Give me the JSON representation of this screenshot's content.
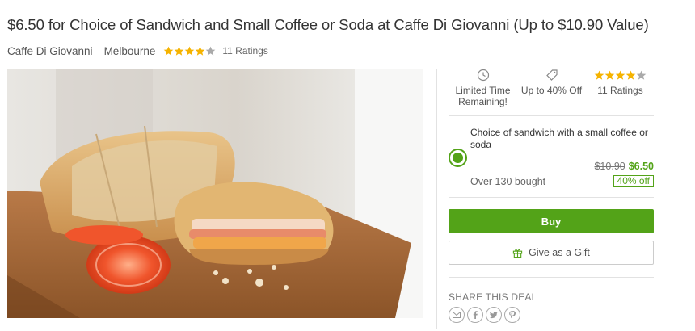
{
  "deal": {
    "title": "$6.50 for Choice of Sandwich and Small Coffee or Soda at Caffe Di Giovanni (Up to $10.90 Value)",
    "merchant": "Caffe Di Giovanni",
    "location": "Melbourne",
    "rating_stars": 4,
    "rating_max": 5,
    "ratings_label": "11 Ratings"
  },
  "colors": {
    "accent_green": "#53a318",
    "star_gold": "#f5b300",
    "star_grey": "#aaaaaa"
  },
  "highlights": [
    {
      "icon": "clock-icon",
      "label": "Limited Time Remaining!"
    },
    {
      "icon": "tag-icon",
      "label": "Up to 40% Off"
    },
    {
      "icon": "stars-icon",
      "label": "11 Ratings"
    }
  ],
  "option": {
    "title": "Choice of sandwich with a small coffee or soda",
    "original_price": "$10.90",
    "price": "$6.50",
    "bought": "Over 130 bought",
    "discount": "40% off",
    "selected": true
  },
  "buttons": {
    "buy": "Buy",
    "gift": "Give as a Gift"
  },
  "share": {
    "label": "SHARE THIS DEAL",
    "icons": [
      "email-icon",
      "facebook-icon",
      "twitter-icon",
      "pinterest-icon"
    ]
  }
}
